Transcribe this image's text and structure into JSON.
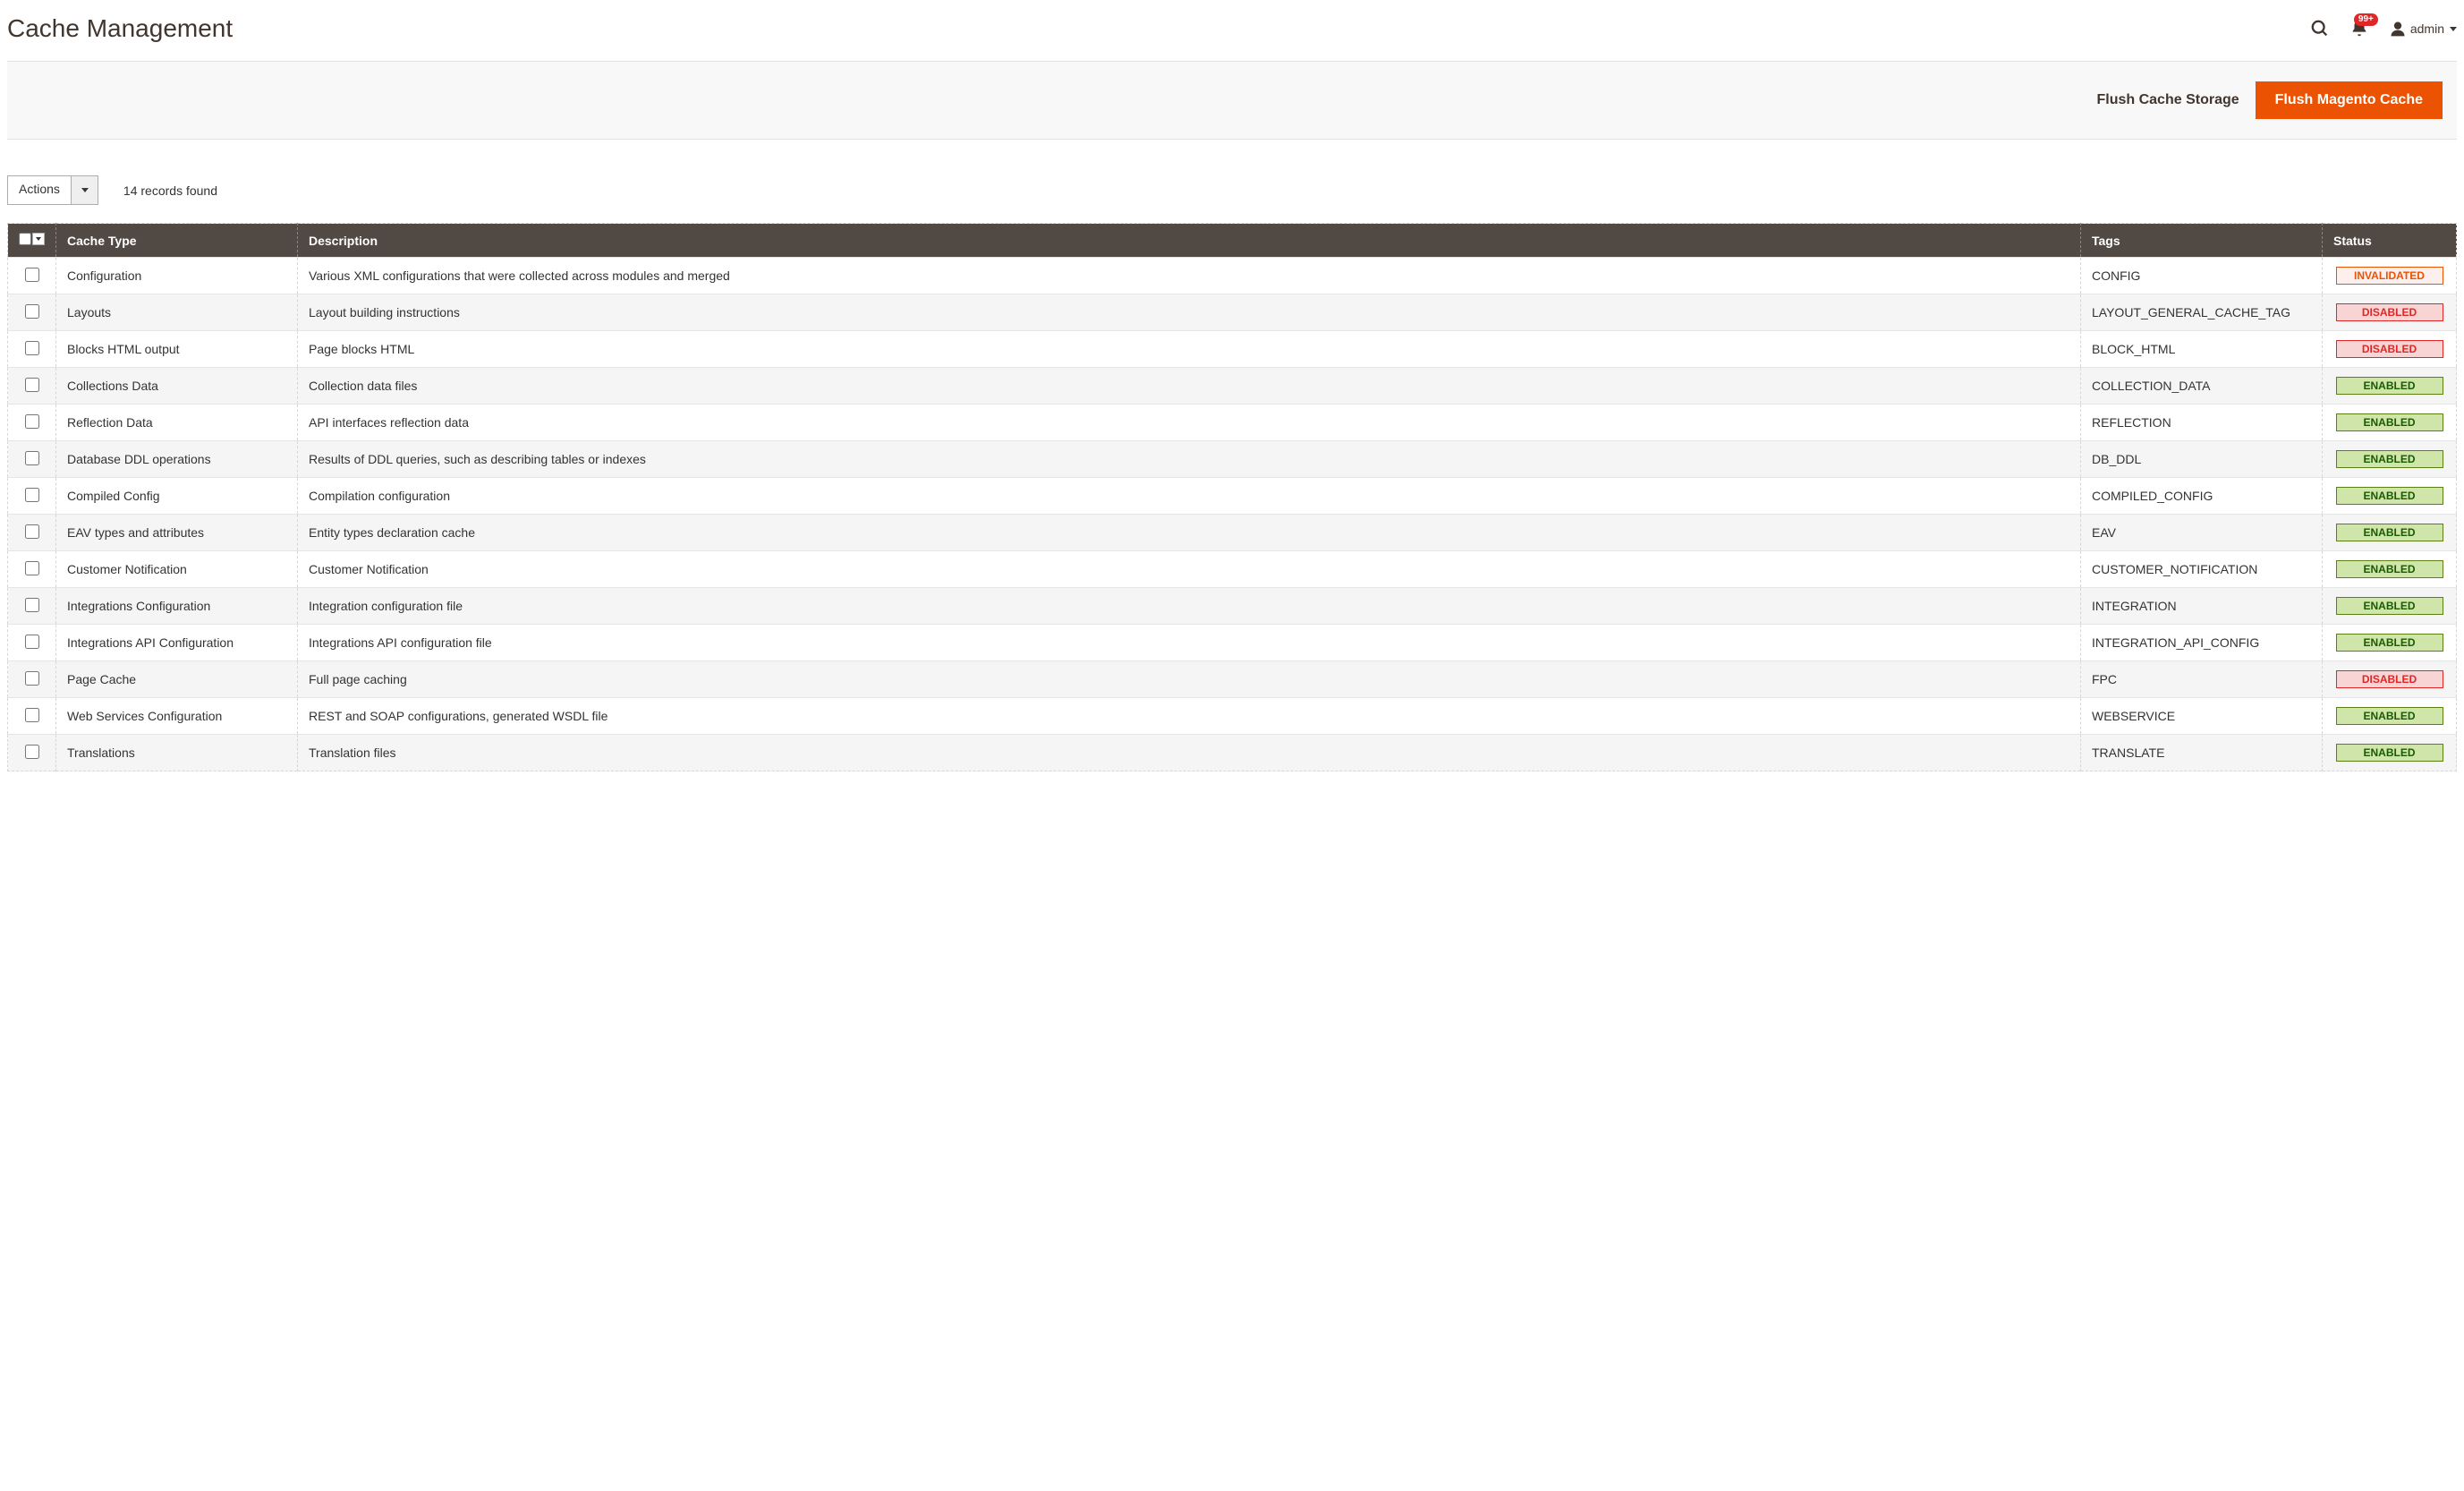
{
  "header": {
    "title": "Cache Management",
    "notification_count": "99+",
    "user_label": "admin"
  },
  "toolbar": {
    "flush_storage": "Flush Cache Storage",
    "flush_magento": "Flush Magento Cache"
  },
  "grid_controls": {
    "actions_label": "Actions",
    "records_found": "14 records found"
  },
  "columns": {
    "cache_type": "Cache Type",
    "description": "Description",
    "tags": "Tags",
    "status": "Status"
  },
  "rows": [
    {
      "type": "Configuration",
      "description": "Various XML configurations that were collected across modules and merged",
      "tags": "CONFIG",
      "status": "INVALIDATED",
      "status_kind": "invalidated"
    },
    {
      "type": "Layouts",
      "description": "Layout building instructions",
      "tags": "LAYOUT_GENERAL_CACHE_TAG",
      "status": "DISABLED",
      "status_kind": "disabled"
    },
    {
      "type": "Blocks HTML output",
      "description": "Page blocks HTML",
      "tags": "BLOCK_HTML",
      "status": "DISABLED",
      "status_kind": "disabled"
    },
    {
      "type": "Collections Data",
      "description": "Collection data files",
      "tags": "COLLECTION_DATA",
      "status": "ENABLED",
      "status_kind": "enabled"
    },
    {
      "type": "Reflection Data",
      "description": "API interfaces reflection data",
      "tags": "REFLECTION",
      "status": "ENABLED",
      "status_kind": "enabled"
    },
    {
      "type": "Database DDL operations",
      "description": "Results of DDL queries, such as describing tables or indexes",
      "tags": "DB_DDL",
      "status": "ENABLED",
      "status_kind": "enabled"
    },
    {
      "type": "Compiled Config",
      "description": "Compilation configuration",
      "tags": "COMPILED_CONFIG",
      "status": "ENABLED",
      "status_kind": "enabled"
    },
    {
      "type": "EAV types and attributes",
      "description": "Entity types declaration cache",
      "tags": "EAV",
      "status": "ENABLED",
      "status_kind": "enabled"
    },
    {
      "type": "Customer Notification",
      "description": "Customer Notification",
      "tags": "CUSTOMER_NOTIFICATION",
      "status": "ENABLED",
      "status_kind": "enabled"
    },
    {
      "type": "Integrations Configuration",
      "description": "Integration configuration file",
      "tags": "INTEGRATION",
      "status": "ENABLED",
      "status_kind": "enabled"
    },
    {
      "type": "Integrations API Configuration",
      "description": "Integrations API configuration file",
      "tags": "INTEGRATION_API_CONFIG",
      "status": "ENABLED",
      "status_kind": "enabled"
    },
    {
      "type": "Page Cache",
      "description": "Full page caching",
      "tags": "FPC",
      "status": "DISABLED",
      "status_kind": "disabled"
    },
    {
      "type": "Web Services Configuration",
      "description": "REST and SOAP configurations, generated WSDL file",
      "tags": "WEBSERVICE",
      "status": "ENABLED",
      "status_kind": "enabled"
    },
    {
      "type": "Translations",
      "description": "Translation files",
      "tags": "TRANSLATE",
      "status": "ENABLED",
      "status_kind": "enabled"
    }
  ]
}
